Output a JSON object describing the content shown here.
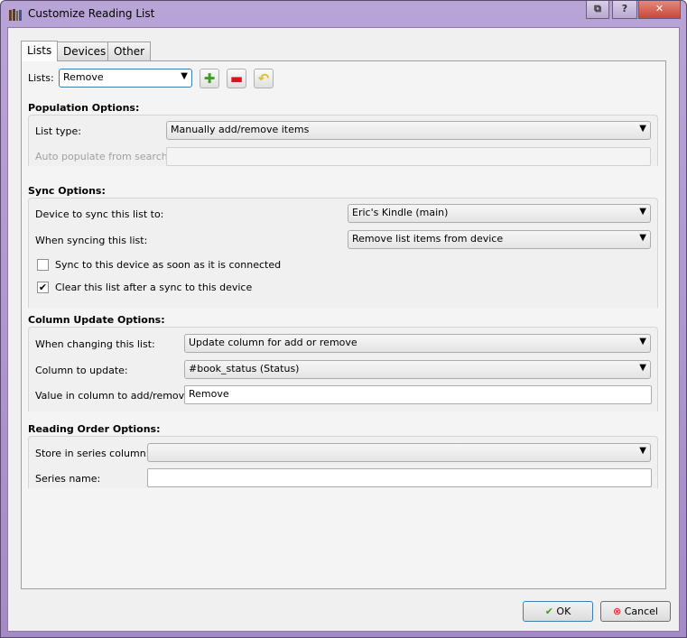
{
  "window": {
    "title": "Customize Reading List",
    "icon": "bookshelf-icon",
    "caption_buttons": [
      "restore-icon",
      "help-icon",
      "close-icon"
    ]
  },
  "tabs": [
    {
      "label": "Lists",
      "active": true
    },
    {
      "label": "Devices"
    },
    {
      "label": "Other"
    }
  ],
  "lists": {
    "label": "Lists:",
    "value": "Remove",
    "add_icon": "plus-icon",
    "remove_icon": "minus-icon",
    "undo_icon": "undo-icon"
  },
  "population": {
    "title": "Population Options:",
    "list_type_label": "List type:",
    "list_type_value": "Manually add/remove items",
    "auto_label": "Auto populate from search:",
    "auto_value": ""
  },
  "sync": {
    "title": "Sync Options:",
    "device_label": "Device to sync this list to:",
    "device_value": "Eric's Kindle (main)",
    "when_label": "When syncing this list:",
    "when_value": "Remove list items from device",
    "sync_connected_label": "Sync to this device as soon as it is connected",
    "sync_connected_checked": false,
    "clear_label": "Clear this list after a sync to this device",
    "clear_checked": true
  },
  "column": {
    "title": "Column Update Options:",
    "when_label": "When changing this list:",
    "when_value": "Update column for add or remove",
    "column_label": "Column to update:",
    "column_value": "#book_status (Status)",
    "value_label": "Value in column to add/remove:",
    "value_value": "Remove"
  },
  "reading": {
    "title": "Reading Order Options:",
    "series_col_label": "Store in series column:",
    "series_col_value": "",
    "series_name_label": "Series name:",
    "series_name_value": ""
  },
  "buttons": {
    "ok": "OK",
    "cancel": "Cancel"
  },
  "colors": {
    "titlebar": "#a58ac8",
    "close": "#c9473a",
    "ok_border": "#3c7fb1"
  }
}
